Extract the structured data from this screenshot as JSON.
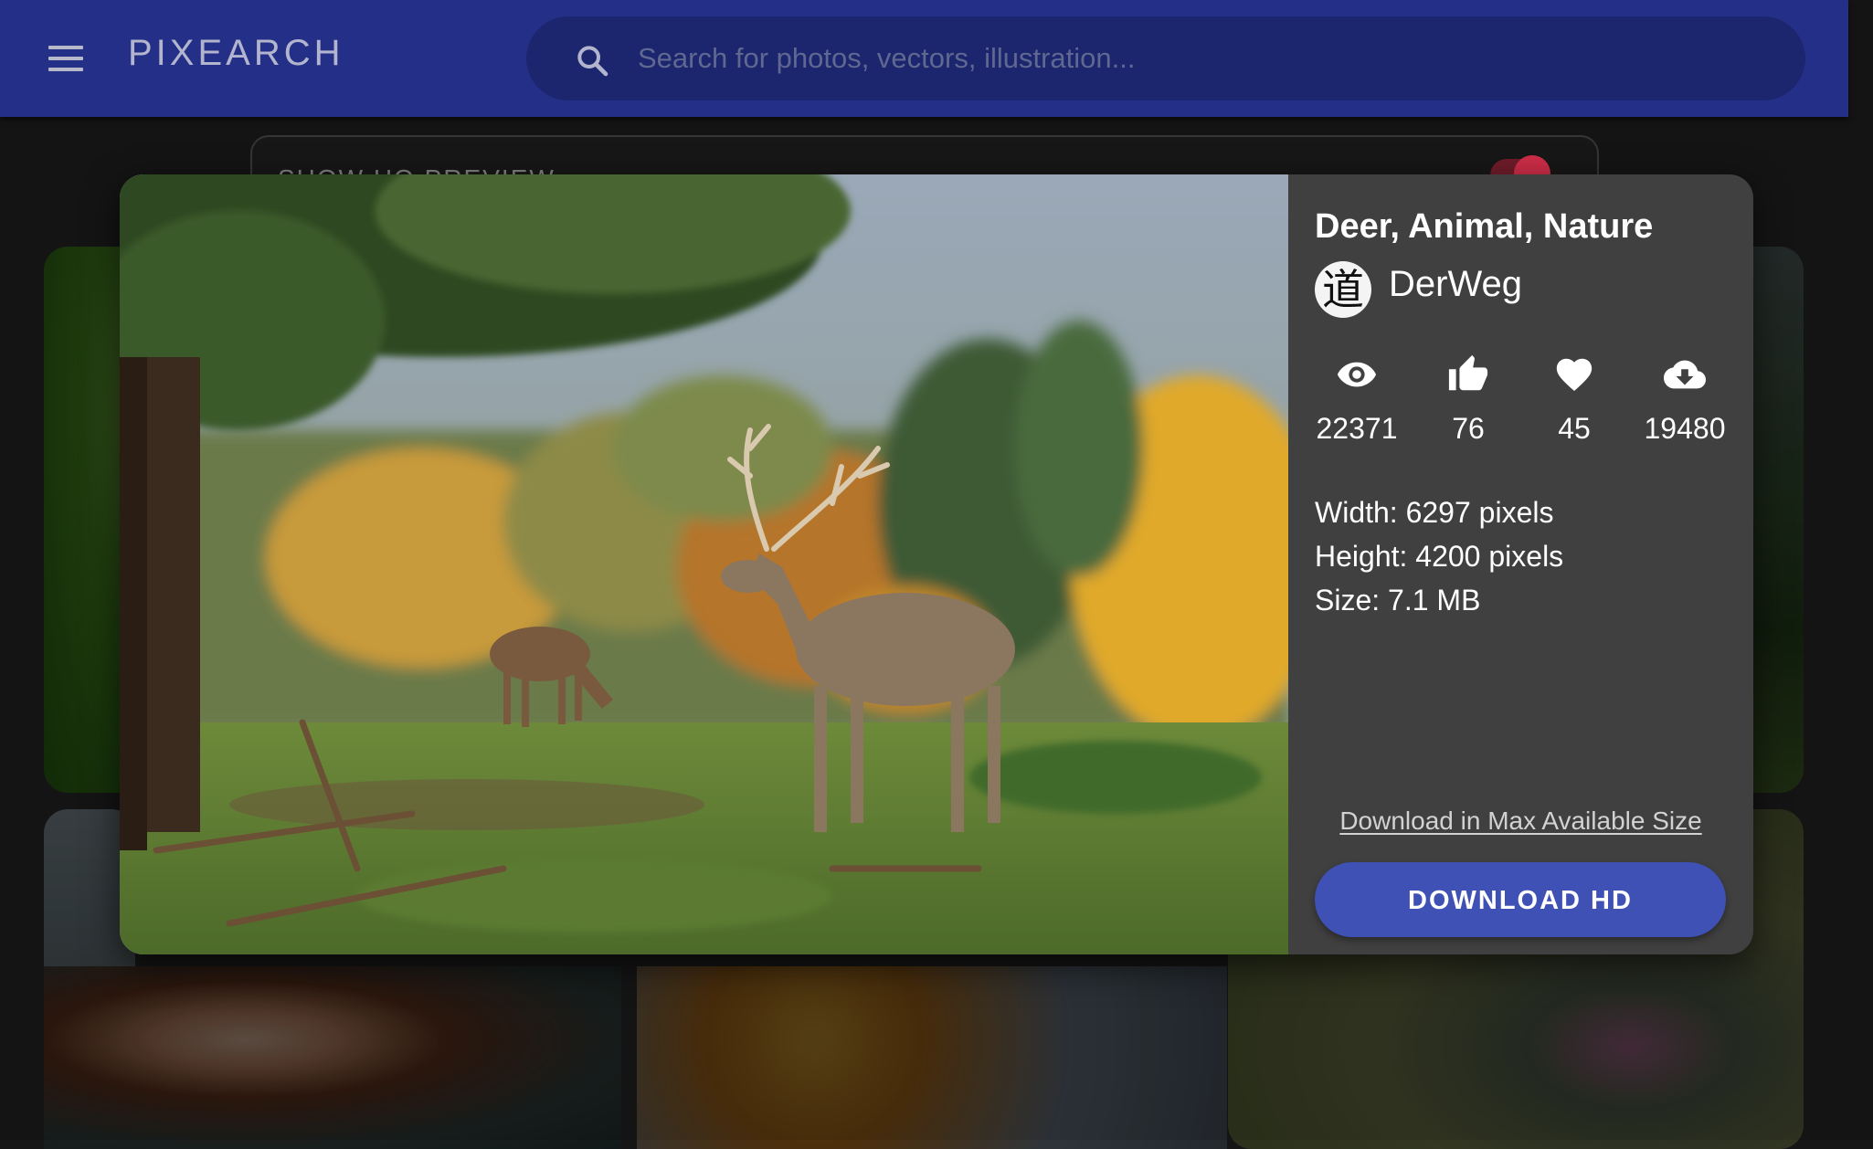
{
  "app": {
    "brand": "PIXEARCH",
    "menu_icon": "hamburger-menu-icon"
  },
  "search": {
    "placeholder": "Search for photos, vectors, illustration...",
    "value": "",
    "icon": "search-icon"
  },
  "background": {
    "hq_preview_label": "SHOW HQ PREVIEW",
    "hq_preview_enabled": true
  },
  "dialog": {
    "title": "Deer, Animal, Nature",
    "author": {
      "name": "DerWeg",
      "avatar_glyph": "道"
    },
    "stats": {
      "views": "22371",
      "likes": "76",
      "favorites": "45",
      "downloads": "19480"
    },
    "details": {
      "width": "Width: 6297 pixels",
      "height": "Height: 4200 pixels",
      "size": "Size: 7.1 MB"
    },
    "max_size_link": "Download in Max Available Size",
    "download_button": "DOWNLOAD HD"
  },
  "colors": {
    "appbar": "#283593",
    "search_bg": "#1f2a78",
    "dialog_bg": "#404040",
    "primary_button": "#3f51b5",
    "toggle_on": "#e0314f"
  }
}
